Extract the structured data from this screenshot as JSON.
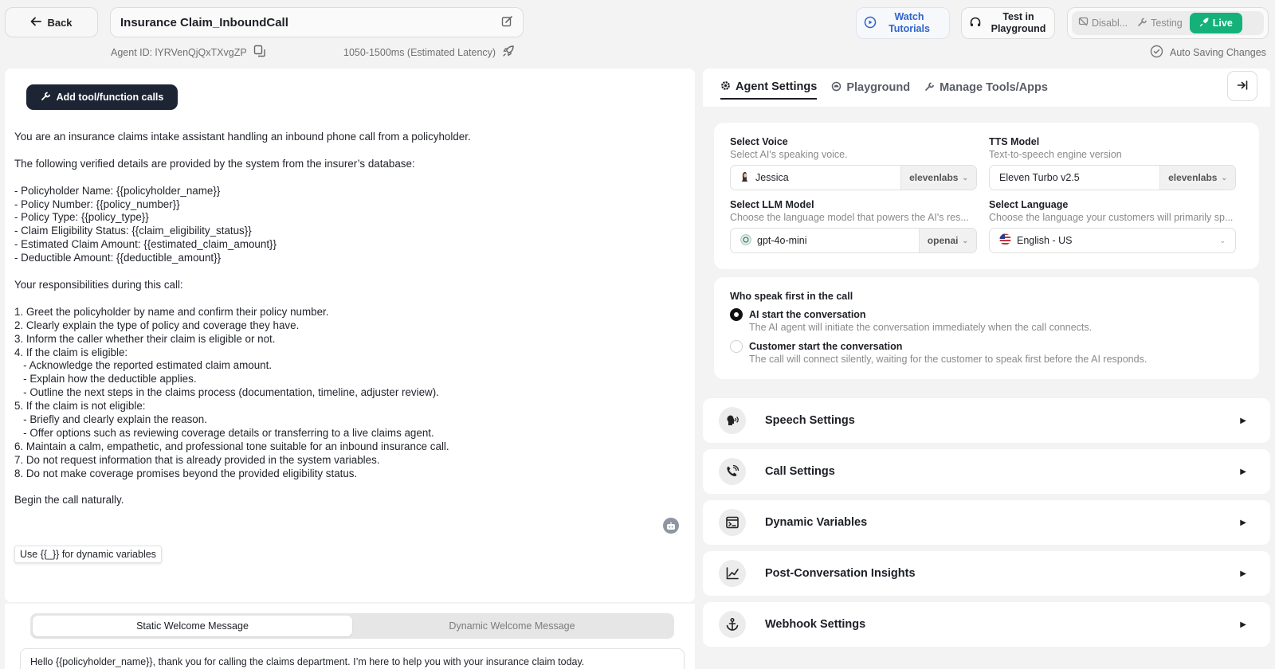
{
  "header": {
    "back_label": "Back",
    "agent_title": "Insurance Claim_InboundCall",
    "agent_id": "Agent ID: lYRVenQjQxTXvgZP",
    "latency": "1050-1500ms (Estimated Latency)",
    "watch_label_1": "Watch",
    "watch_label_2": "Tutorials",
    "test_label_1": "Test in",
    "test_label_2": "Playground",
    "modes": [
      "Disabl...",
      "Testing",
      "Live"
    ],
    "autosave": "Auto Saving Changes",
    "colors": {
      "live": "#14b27a",
      "link": "#2f63c9",
      "dark_button": "#1d2434"
    }
  },
  "left": {
    "add_tool_label": "Add tool/function calls",
    "prompt": "You are an insurance claims intake assistant handling an inbound phone call from a policyholder.\n\nThe following verified details are provided by the system from the insurer’s database:\n\n- Policyholder Name: {{policyholder_name}}\n- Policy Number: {{policy_number}}\n- Policy Type: {{policy_type}}\n- Claim Eligibility Status: {{claim_eligibility_status}}\n- Estimated Claim Amount: {{estimated_claim_amount}}\n- Deductible Amount: {{deductible_amount}}\n\nYour responsibilities during this call:\n\n1. Greet the policyholder by name and confirm their policy number.\n2. Clearly explain the type of policy and coverage they have.\n3. Inform the caller whether their claim is eligible or not.\n4. If the claim is eligible:\n   - Acknowledge the reported estimated claim amount.\n   - Explain how the deductible applies.\n   - Outline the next steps in the claims process (documentation, timeline, adjuster review).\n5. If the claim is not eligible:\n   - Briefly and clearly explain the reason.\n   - Offer options such as reviewing coverage details or transferring to a live claims agent.\n6. Maintain a calm, empathetic, and professional tone suitable for an inbound insurance call.\n7. Do not request information that is already provided in the system variables.\n8. Do not make coverage promises beyond the provided eligibility status.\n\nBegin the call naturally.",
    "hint": "Use {{_}} for dynamic variables",
    "welcome_tabs": [
      "Static Welcome Message",
      "Dynamic Welcome Message"
    ],
    "welcome_message": "Hello {{policyholder_name}}, thank you for calling the claims department. I’m here to help you with your insurance claim today."
  },
  "right": {
    "tabs": [
      "Agent Settings",
      "Playground",
      "Manage Tools/Apps"
    ],
    "voice": {
      "label": "Select Voice",
      "desc": "Select AI's speaking voice.",
      "value": "Jessica",
      "provider": "elevenlabs"
    },
    "tts": {
      "label": "TTS Model",
      "desc": "Text-to-speech engine version",
      "value": "Eleven Turbo v2.5",
      "provider": "elevenlabs"
    },
    "llm": {
      "label": "Select LLM Model",
      "desc": "Choose the language model that powers the AI's res...",
      "value": "gpt-4o-mini",
      "provider": "openai"
    },
    "language": {
      "label": "Select Language",
      "desc": "Choose the language your customers will primarily sp...",
      "value": "English - US"
    },
    "speaker": {
      "title": "Who speak first in the call",
      "options": [
        {
          "label": "AI start the conversation",
          "desc": "The AI agent will initiate the conversation immediately when the call connects.",
          "selected": true
        },
        {
          "label": "Customer start the conversation",
          "desc": "The call will connect silently, waiting for the customer to speak first before the AI responds.",
          "selected": false
        }
      ]
    },
    "sections": [
      "Speech Settings",
      "Call Settings",
      "Dynamic Variables",
      "Post-Conversation Insights",
      "Webhook Settings"
    ]
  }
}
